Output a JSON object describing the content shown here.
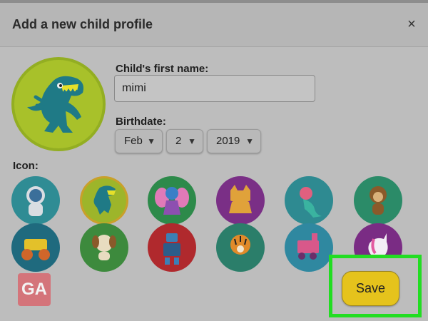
{
  "dialog": {
    "title": "Add a new child profile",
    "close_glyph": "×"
  },
  "profile": {
    "avatar_icon": "dinosaur-icon",
    "name_label": "Child's first name:",
    "name_value": "mimi",
    "birthdate_label": "Birthdate:",
    "month": "Feb",
    "day": "2",
    "year": "2019"
  },
  "icons": {
    "label": "Icon:",
    "items": [
      {
        "name": "astronaut-icon",
        "bg": "#2f8c94"
      },
      {
        "name": "dinosaur-icon",
        "bg": "#8fa82a",
        "selected": true
      },
      {
        "name": "fairy-icon",
        "bg": "#2d8a4a"
      },
      {
        "name": "cat-icon",
        "bg": "#7a2f86"
      },
      {
        "name": "mermaid-icon",
        "bg": "#2e8a91"
      },
      {
        "name": "monkey-icon",
        "bg": "#2b8b68"
      },
      {
        "name": "monster-truck-icon",
        "bg": "#1f6a7e"
      },
      {
        "name": "puppy-icon",
        "bg": "#3d8a3d"
      },
      {
        "name": "robot-icon",
        "bg": "#b0292d"
      },
      {
        "name": "tiger-icon",
        "bg": "#2b7e6a"
      },
      {
        "name": "train-icon",
        "bg": "#2f88a0"
      },
      {
        "name": "unicorn-icon",
        "bg": "#7a2c84"
      }
    ]
  },
  "watermark": {
    "text": "GA"
  },
  "actions": {
    "save_label": "Save"
  },
  "colors": {
    "save_button": "#e5c31c",
    "highlight_frame": "#22dd22"
  }
}
